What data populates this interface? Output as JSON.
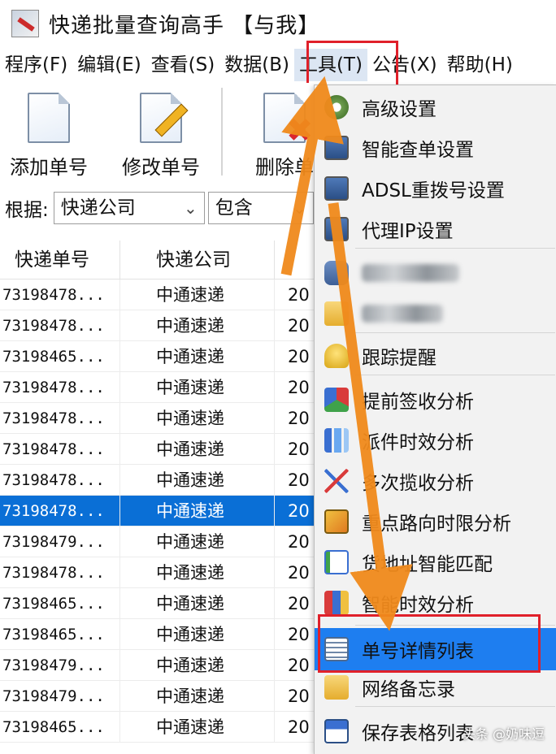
{
  "window": {
    "title": "快递批量查询高手 【与我】"
  },
  "menubar": {
    "items": [
      "程序(F)",
      "编辑(E)",
      "查看(S)",
      "数据(B)",
      "工具(T)",
      "公告(X)",
      "帮助(H)"
    ],
    "active": "工具(T)"
  },
  "toolbar": {
    "add_label": "添加单号",
    "edit_label": "修改单号",
    "delete_label": "删除单"
  },
  "filter": {
    "label": "根据:",
    "field_value": "快递公司",
    "op_value": "包含"
  },
  "table": {
    "headers": [
      "快递单号",
      "快递公司",
      ""
    ],
    "rows": [
      [
        "73198478...",
        "中通速递",
        "20"
      ],
      [
        "73198478...",
        "中通速递",
        "20"
      ],
      [
        "73198465...",
        "中通速递",
        "20"
      ],
      [
        "73198478...",
        "中通速递",
        "20"
      ],
      [
        "73198478...",
        "中通速递",
        "20"
      ],
      [
        "73198478...",
        "中通速递",
        "20"
      ],
      [
        "73198478...",
        "中通速递",
        "20"
      ],
      [
        "73198478...",
        "中通速递",
        "20"
      ],
      [
        "73198479...",
        "中通速递",
        "20"
      ],
      [
        "73198478...",
        "中通速递",
        "20"
      ],
      [
        "73198465...",
        "中通速递",
        "20"
      ],
      [
        "73198465...",
        "中通速递",
        "20"
      ],
      [
        "73198479...",
        "中通速递",
        "20"
      ],
      [
        "73198479...",
        "中通速递",
        "20"
      ],
      [
        "73198465...",
        "中通速递",
        "20"
      ]
    ],
    "selected_row": 7
  },
  "tools_menu": {
    "items": [
      {
        "label": "高级设置",
        "icon": "gear-icon"
      },
      {
        "label": "智能查单设置",
        "icon": "monitor-icon"
      },
      {
        "label": "ADSL重拨号设置",
        "icon": "monitor-icon"
      },
      {
        "label": "代理IP设置",
        "icon": "monitor-icon"
      },
      {
        "label": "",
        "icon": "truck-icon"
      },
      {
        "label": "",
        "icon": "folder-icon"
      },
      {
        "label": "跟踪提醒",
        "icon": "bell-icon"
      },
      {
        "label": "提前签收分析",
        "icon": "cubes-icon"
      },
      {
        "label": "派件时效分析",
        "icon": "bar-chart-icon"
      },
      {
        "label": "多次揽收分析",
        "icon": "line-chart-icon"
      },
      {
        "label": "重点路向时限分析",
        "icon": "map-icon"
      },
      {
        "label": "货地址智能匹配",
        "icon": "checklist-icon"
      },
      {
        "label": "智能时效分析",
        "icon": "chart-pen-icon"
      },
      {
        "label": "单号详情列表",
        "icon": "list-icon"
      },
      {
        "label": "网络备忘录",
        "icon": "folder-icon"
      },
      {
        "label": "保存表格列表",
        "icon": "save-icon"
      }
    ],
    "selected": "单号详情列表"
  },
  "watermark": "头条 @奶味逗",
  "colors": {
    "accent": "#1e7ef0",
    "selection": "#0a6fd6",
    "annotation": "#e0202a",
    "arrow": "#f08a1c"
  }
}
